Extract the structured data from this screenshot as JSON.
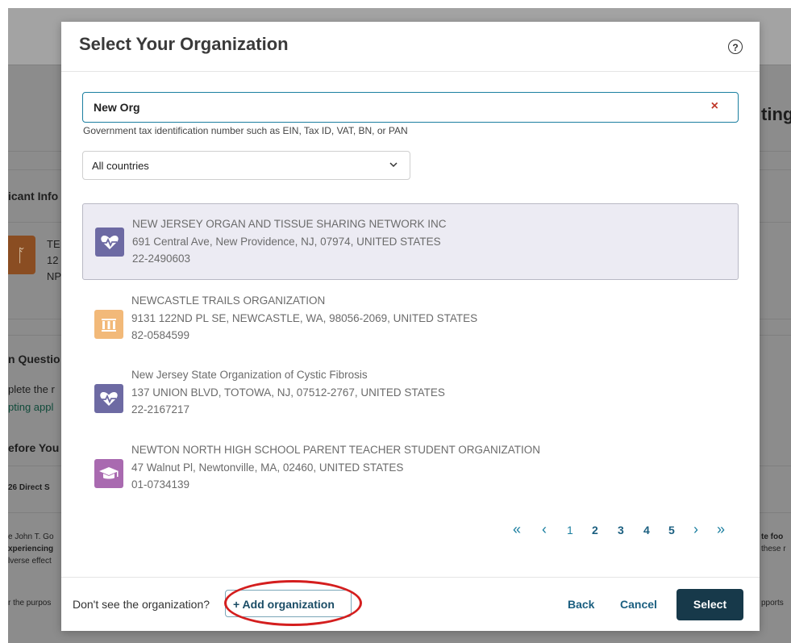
{
  "background": {
    "left_fragments": [
      "icant Info",
      "TE",
      "12",
      "NP",
      "n Questio",
      "plete the r",
      "pting appl",
      "efore You",
      "26 Direct S",
      "e John T. Go",
      "xperiencing",
      "lverse effect",
      "r the purpos"
    ],
    "right_fragments": [
      "ting",
      "te foo",
      "these r",
      "pports"
    ]
  },
  "modal": {
    "title": "Select Your Organization",
    "help_label": "?",
    "search": {
      "value": "New Org",
      "clear_label": "×",
      "hint": "Government tax identification number such as EIN, Tax ID, VAT, BN, or PAN"
    },
    "country_select": {
      "value": "All countries"
    },
    "results": [
      {
        "name": "NEW JERSEY ORGAN AND TISSUE SHARING NETWORK INC",
        "address": "691 Central Ave, New Providence, NJ, 07974, UNITED STATES",
        "ein": "22-2490603",
        "icon": "heart-pulse-icon",
        "icon_color": "#6d6aa3",
        "selected": true
      },
      {
        "name": "NEWCASTLE TRAILS ORGANIZATION",
        "address": "9131 122ND PL SE, NEWCASTLE, WA, 98056-2069, UNITED STATES",
        "ein": "82-0584599",
        "icon": "columns-icon",
        "icon_color": "#f2b979",
        "selected": false
      },
      {
        "name": "New Jersey State Organization of Cystic Fibrosis",
        "address": "137 UNION BLVD, TOTOWA, NJ, 07512-2767, UNITED STATES",
        "ein": "22-2167217",
        "icon": "heart-pulse-icon",
        "icon_color": "#6d6aa3",
        "selected": false
      },
      {
        "name": "NEWTON NORTH HIGH SCHOOL PARENT TEACHER STUDENT ORGANIZATION",
        "address": "47 Walnut Pl, Newtonville, MA, 02460, UNITED STATES",
        "ein": "01-0734139",
        "icon": "graduation-cap-icon",
        "icon_color": "#a96ab0",
        "selected": false
      }
    ],
    "pagination": {
      "first": "«",
      "prev": "‹",
      "pages": [
        "1",
        "2",
        "3",
        "4",
        "5"
      ],
      "current": "1",
      "next": "›",
      "last": "»"
    },
    "footer": {
      "prompt": "Don't see the organization?",
      "add_label": "+ Add organization",
      "back_label": "Back",
      "cancel_label": "Cancel",
      "select_label": "Select"
    }
  },
  "colors": {
    "accent": "#1b7fa0",
    "primary_button": "#17394a",
    "highlight_annotation": "#d41e1e"
  }
}
